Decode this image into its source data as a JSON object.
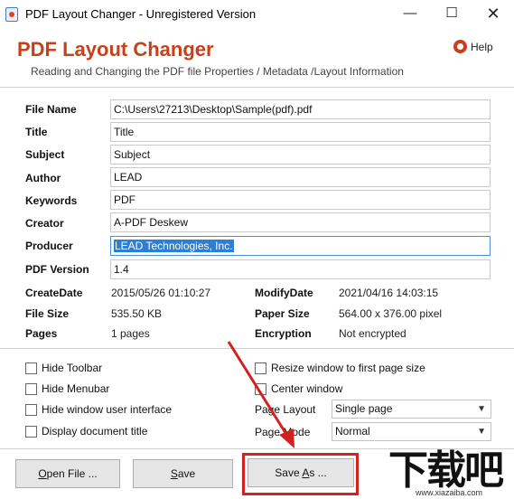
{
  "window": {
    "title": "PDF Layout Changer - Unregistered Version",
    "minimize": "—",
    "maximize": "☐",
    "close": "✕"
  },
  "header": {
    "app_name": "PDF Layout Changer",
    "subtitle": "Reading and Changing the PDF file Properties / Metadata /Layout Information",
    "help_label": "Help"
  },
  "fields": [
    {
      "label": "File Name",
      "value": "C:\\Users\\27213\\Desktop\\Sample(pdf).pdf"
    },
    {
      "label": "Title",
      "value": "Title"
    },
    {
      "label": "Subject",
      "value": "Subject"
    },
    {
      "label": "Author",
      "value": "LEAD"
    },
    {
      "label": "Keywords",
      "value": "PDF"
    },
    {
      "label": "Creator",
      "value": "A-PDF Deskew"
    },
    {
      "label": "Producer",
      "value": "LEAD Technologies, Inc."
    },
    {
      "label": "PDF Version",
      "value": "1.4"
    }
  ],
  "info": {
    "create_label": "CreateDate",
    "create_value": "2015/05/26 01:10:27",
    "modify_label": "ModifyDate",
    "modify_value": "2021/04/16 14:03:15",
    "size_label": "File Size",
    "size_value": "535.50 KB",
    "paper_label": "Paper Size",
    "paper_value": "564.00 x 376.00 pixel",
    "pages_label": "Pages",
    "pages_value": "1 pages",
    "enc_label": "Encryption",
    "enc_value": "Not encrypted"
  },
  "options": {
    "hide_toolbar": "Hide Toolbar",
    "hide_menubar": "Hide Menubar",
    "hide_window_ui": "Hide window user interface",
    "display_doc_title": "Display document title",
    "resize_window": "Resize window to first page size",
    "center_window": "Center window",
    "page_layout_label": "Page Layout",
    "page_layout_value": "Single page",
    "page_mode_label": "Page Mode",
    "page_mode_value": "Normal"
  },
  "buttons": {
    "open_u": "O",
    "open_rest": "pen File ...",
    "save_u": "S",
    "save_rest": "ave",
    "saveas_pre": "Save ",
    "saveas_u": "A",
    "saveas_rest": "s ..."
  },
  "watermark": {
    "logo": "下载吧",
    "url": "www.xiazaiba.com"
  },
  "colors": {
    "brand": "#c8401a",
    "selection": "#2f7fd0",
    "highlight": "#d42020"
  }
}
